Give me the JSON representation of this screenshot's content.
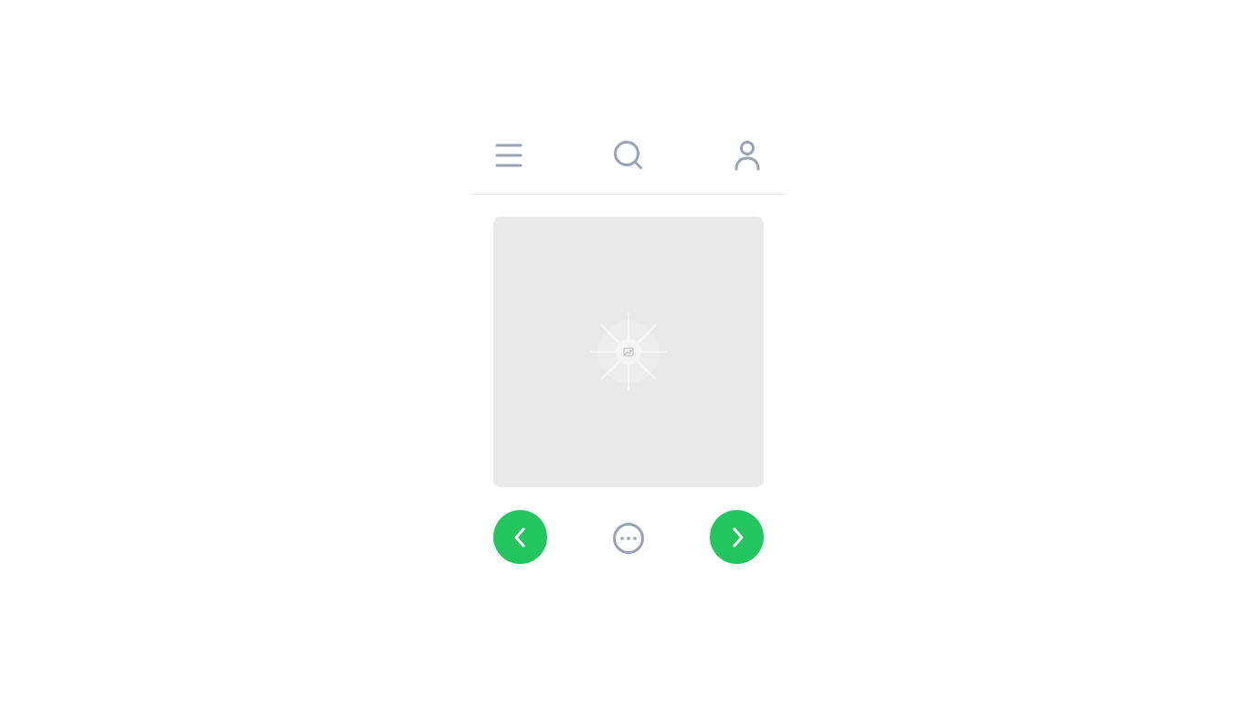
{
  "header": {
    "icons": {
      "menu": "menu-icon",
      "search": "search-icon",
      "profile": "user-icon"
    }
  },
  "media": {
    "placeholder_icon": "image-icon",
    "background": "#e9e9e9"
  },
  "controls": {
    "previous_icon": "chevron-left-icon",
    "next_icon": "chevron-right-icon",
    "more_icon": "more-horizontal-icon",
    "accent": "#22c55e"
  },
  "colors": {
    "icon": "#9ca3af",
    "divider": "#e5e7eb"
  }
}
